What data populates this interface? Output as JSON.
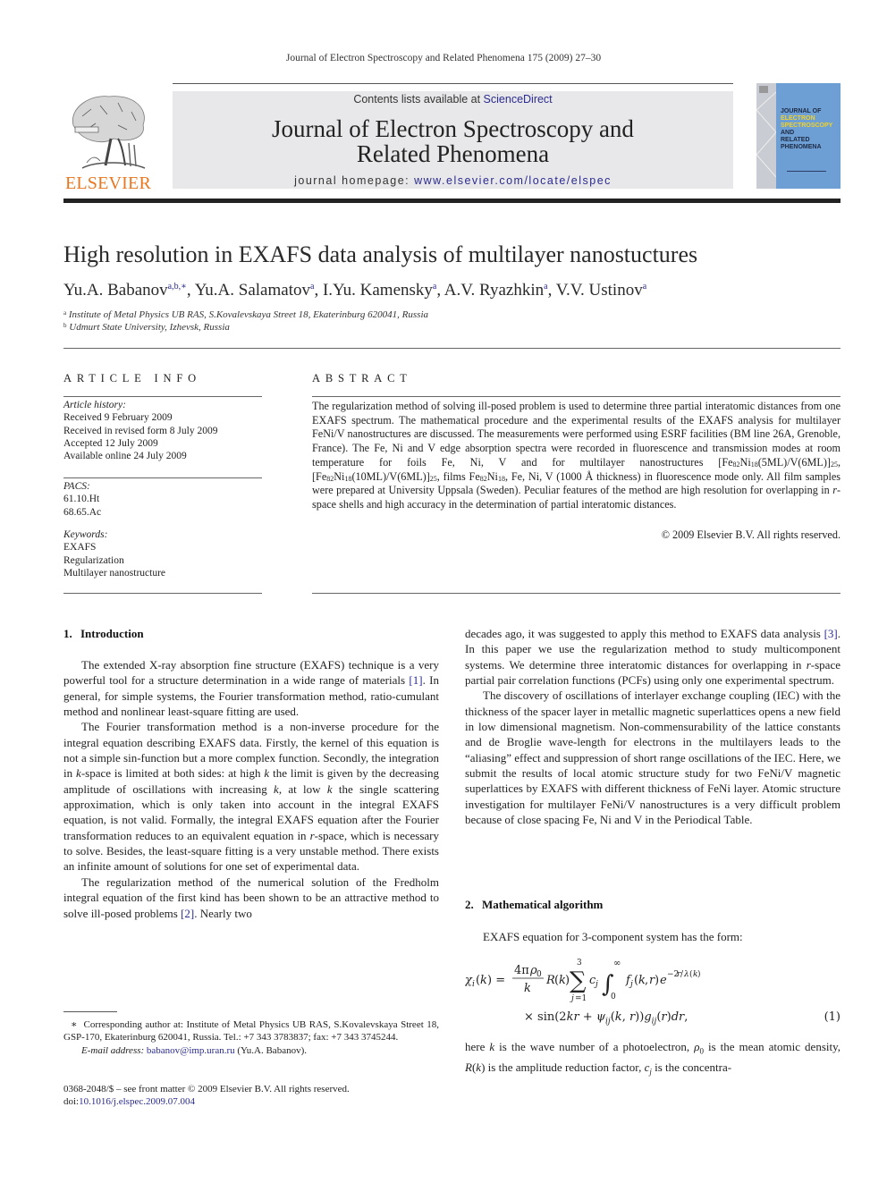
{
  "running_header": "Journal of Electron Spectroscopy and Related Phenomena 175 (2009) 27–30",
  "publisher": {
    "logo_word": "ELSEVIER",
    "brand_color": "#e87722"
  },
  "banner": {
    "contents_prefix": "Contents lists available at ",
    "contents_link": "ScienceDirect",
    "journal_title_line1": "Journal of Electron Spectroscopy and",
    "journal_title_line2": "Related Phenomena",
    "homepage_prefix": "journal homepage: ",
    "homepage_link": "www.elsevier.com/locate/elspec",
    "background_color": "#e8e8ea",
    "link_color": "#2b2b8f"
  },
  "cover": {
    "line1": "JOURNAL OF",
    "line2": "ELECTRON",
    "line3": "SPECTROSCOPY",
    "line4": "AND",
    "line5": "RELATED PHENOMENA",
    "color": "#6d9fd4"
  },
  "article": {
    "title": "High resolution in EXAFS data analysis of multilayer nanostuctures",
    "authors": [
      {
        "name": "Yu.A. Babanov",
        "sup": "a,b,∗",
        "sep": ", "
      },
      {
        "name": "Yu.A. Salamatov",
        "sup": "a",
        "sep": ", "
      },
      {
        "name": "I.Yu. Kamensky",
        "sup": "a",
        "sep": ", "
      },
      {
        "name": "A.V. Ryazhkin",
        "sup": "a",
        "sep": ", "
      },
      {
        "name": "V.V. Ustinov",
        "sup": "a",
        "sep": ""
      }
    ],
    "affiliations": [
      {
        "mark": "a",
        "text": "Institute of Metal Physics UB RAS, S.Kovalevskaya Street 18, Ekaterinburg 620041, Russia"
      },
      {
        "mark": "b",
        "text": "Udmurt State University, Izhevsk, Russia"
      }
    ]
  },
  "article_info": {
    "heading": "ARTICLE INFO",
    "history_label": "Article history:",
    "history": [
      "Received 9 February 2009",
      "Received in revised form 8 July 2009",
      "Accepted 12 July 2009",
      "Available online 24 July 2009"
    ],
    "pacs_label": "PACS:",
    "pacs": [
      "61.10.Ht",
      "68.65.Ac"
    ],
    "keywords_label": "Keywords:",
    "keywords": [
      "EXAFS",
      "Regularization",
      "Multilayer nanostructure"
    ]
  },
  "abstract": {
    "heading": "ABSTRACT",
    "text_1": "The regularization method of solving ill-posed problem is used to determine three partial interatomic distances from one EXAFS spectrum. The mathematical procedure and the experimental results of the EXAFS analysis for multilayer FeNi/V nanostructures are discussed. The measurements were performed using ESRF facilities (BM line 26A, Grenoble, France). The Fe, Ni and V edge absorption spectra were recorded in fluorescence and transmission modes at room temperature for foils Fe, Ni, V and for multilayer nanostructures [Fe",
    "sub_82": "82",
    "ni": "Ni",
    "sub_18": "18",
    "sub_25": "25",
    "part_a": "(5ML)/V(6ML)]",
    "part_b": ", [Fe",
    "part_c": "(10ML)/V(6ML)]",
    "part_d": ", films Fe",
    "text_2": ", Fe, Ni, V (1000 Å thickness) in fluorescence mode only. All film samples were prepared at University Uppsala (Sweden). Peculiar features of the method are high resolution for overlapping in ",
    "r_italic": "r",
    "text_3": "-space shells and high accuracy in the determination of partial interatomic distances.",
    "copyright": "© 2009 Elsevier B.V. All rights reserved."
  },
  "sections": {
    "intro": {
      "number": "1.",
      "title": "Introduction",
      "p1_a": "The extended X-ray absorption fine structure (EXAFS) technique is a very powerful tool for a structure determination in a wide range of materials ",
      "p1_ref": "[1]",
      "p1_b": ". In general, for simple systems, the Fourier transformation method, ratio-cumulant method and nonlinear least-square fitting are used.",
      "p2_a": "The Fourier transformation method is a non-inverse procedure for the integral equation describing EXAFS data. Firstly, the kernel of this equation is not a simple sin-function but a more complex function. Secondly, the integration in ",
      "k": "k",
      "p2_b": "-space is limited at both sides: at high ",
      "p2_c": " the limit is given by the decreasing amplitude of oscillations with increasing ",
      "p2_d": ", at low ",
      "p2_e": " the single scattering approximation, which is only taken into account in the integral EXAFS equation, is not valid. Formally, the integral EXAFS equation after the Fourier transformation reduces to an equivalent equation in ",
      "r": "r",
      "p2_f": "-space, which is necessary to solve. Besides, the least-square fitting is a very unstable method. There exists an infinite amount of solutions for one set of experimental data.",
      "p3_a": "The regularization method of the numerical solution of the Fredholm integral equation of the first kind has been shown to be an attractive method to solve ill-posed problems ",
      "p3_ref": "[2]",
      "p3_b": ". Nearly two"
    },
    "right_col": {
      "p1_a": "decades ago, it was suggested to apply this method to EXAFS data analysis ",
      "p1_ref": "[3]",
      "p1_b": ". In this paper we use the regularization method to study multicomponent systems. We determine three interatomic distances for overlapping in ",
      "r": "r",
      "p1_c": "-space partial pair correlation functions (PCFs) using only one experimental spectrum.",
      "p2": "The discovery of oscillations of interlayer exchange coupling (IEC) with the thickness of the spacer layer in metallic magnetic superlattices opens a new field in low dimensional magnetism. Non-commensurability of the lattice constants and de Broglie wave-length for electrons in the multilayers leads to the “aliasing” effect and suppression of short range oscillations of the IEC. Here, we submit the results of local atomic structure study for two FeNi/V magnetic superlattices by EXAFS with different thickness of FeNi layer. Atomic structure investigation for multilayer FeNi/V nanostructures is a very difficult problem because of close spacing Fe, Ni and V in the Periodical Table."
    },
    "math": {
      "number": "2.",
      "title": "Mathematical algorithm",
      "intro": "EXAFS equation for 3-component system has the form:",
      "equation_number": "(1)",
      "after_a": "here ",
      "after_k": "k",
      "after_b": " is the wave number of a photoelectron, ",
      "after_rho": "ρ",
      "after_rho_sub": "0",
      "after_c": " is the mean atomic density, ",
      "after_R": "R",
      "after_d": "(",
      "after_e": ") is the amplitude reduction factor, ",
      "after_c_sym": "c",
      "after_j": "j",
      "after_f": " is the concentra-"
    }
  },
  "footnotes": {
    "star": "∗",
    "corresponding": "Corresponding author at: Institute of Metal Physics UB RAS, S.Kovalevskaya Street 18, GSP-170, Ekaterinburg 620041, Russia. Tel.: +7 343 3783837; fax: +7 343 3745244.",
    "email_label": "E-mail address:",
    "email": "babanov@imp.uran.ru",
    "email_suffix": " (Yu.A. Babanov).",
    "issn": "0368-2048/$ – see front matter © 2009 Elsevier B.V. All rights reserved.",
    "doi_prefix": "doi:",
    "doi": "10.1016/j.elspec.2009.07.004"
  }
}
